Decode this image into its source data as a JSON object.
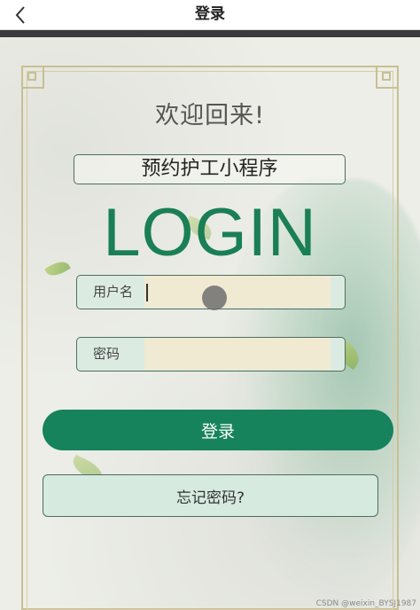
{
  "header": {
    "title": "登录",
    "back_icon": "chevron-left-icon"
  },
  "welcome": "欢迎回来!",
  "app_name": "预约护工小程序",
  "login_word": "LOGIN",
  "username": {
    "label": "用户名",
    "value": ""
  },
  "password": {
    "label": "密码",
    "value": ""
  },
  "login_button": "登录",
  "forgot_button": "忘记密码?",
  "watermark": "CSDN @weixin_BYSJ1987",
  "colors": {
    "brand_green": "#16835d",
    "frame_gold": "#c9bf93",
    "field_bg": "#f0ead3"
  }
}
